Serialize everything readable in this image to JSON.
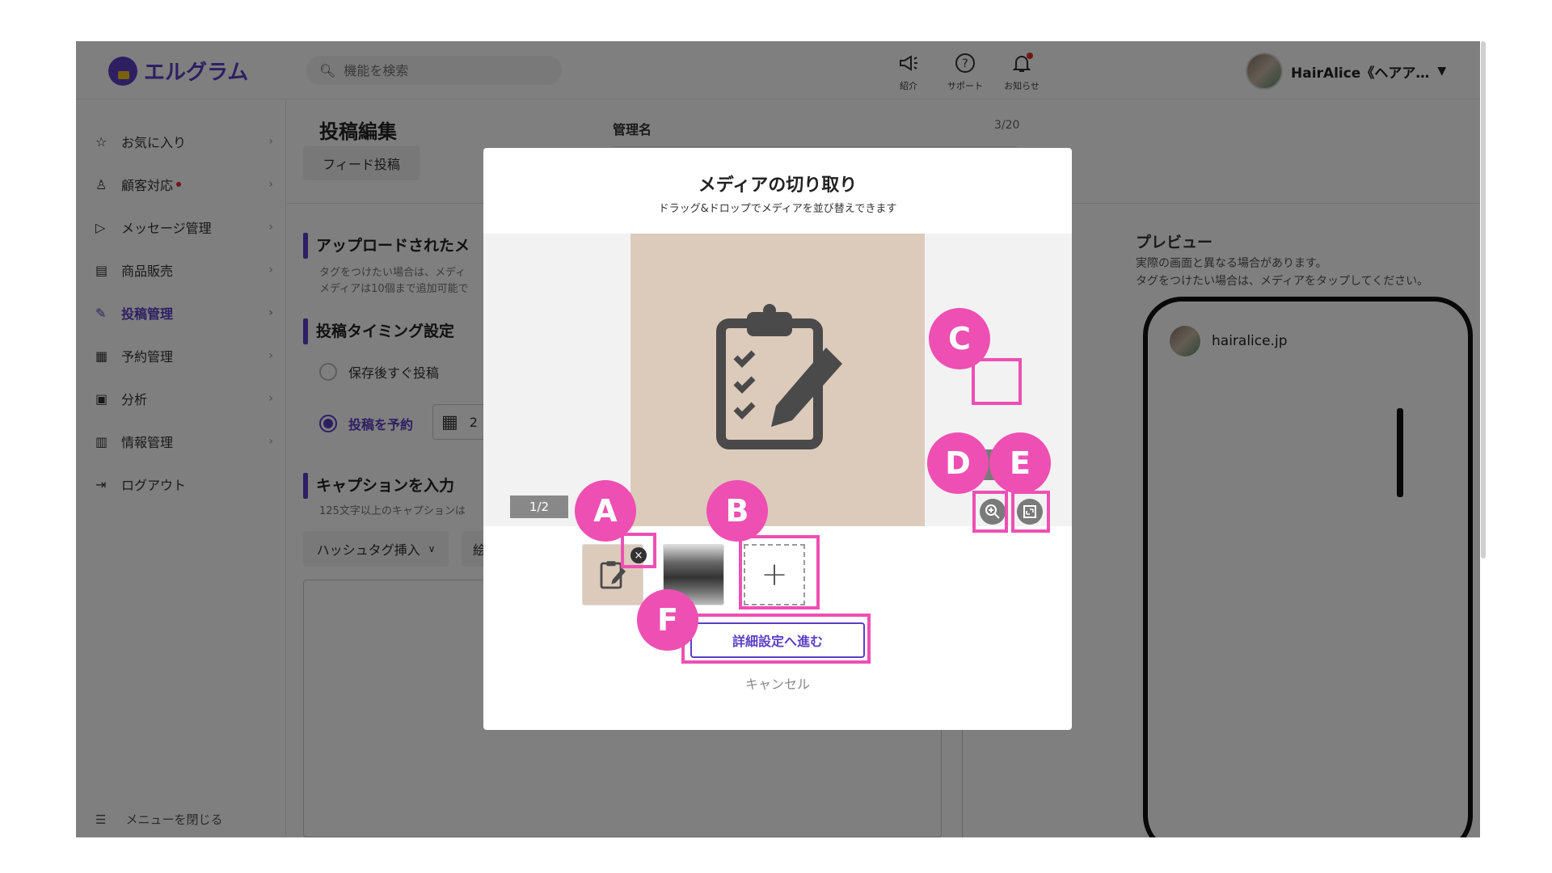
{
  "app": {
    "logo_text": "エルグラム"
  },
  "search": {
    "placeholder": "機能を検索"
  },
  "topbar": {
    "intro_label": "紹介",
    "support_label": "サポート",
    "news_label": "お知らせ",
    "user_name": "HairAlice《ヘアア…"
  },
  "sidebar": {
    "items": [
      {
        "label": "お気に入り",
        "icon": "star-icon"
      },
      {
        "label": "顧客対応",
        "icon": "user-icon"
      },
      {
        "label": "メッセージ管理",
        "icon": "send-icon"
      },
      {
        "label": "商品販売",
        "icon": "store-icon"
      },
      {
        "label": "投稿管理",
        "icon": "edit-icon"
      },
      {
        "label": "予約管理",
        "icon": "calendar-icon"
      },
      {
        "label": "分析",
        "icon": "report-icon"
      },
      {
        "label": "情報管理",
        "icon": "chart-icon"
      },
      {
        "label": "ログアウト",
        "icon": "logout-icon"
      }
    ],
    "close_label": "メニューを閉じる"
  },
  "page": {
    "title": "投稿編集",
    "tab": "フィード投稿",
    "mgmt_label": "管理名",
    "mgmt_count": "3/20",
    "upload_title": "アップロードされたメ",
    "upload_sub1": "タグをつけたい場合は、メディ",
    "upload_sub2": "メディアは10個まで追加可能で",
    "timing_title": "投稿タイミング設定",
    "radio_now": "保存後すぐ投稿",
    "radio_schedule": "投稿を予約",
    "date_value": "2",
    "caption_title": "キャプションを入力",
    "caption_sub": "125文字以上のキャプションは",
    "hashtag_btn": "ハッシュタグ挿入",
    "emoji_btn": "絵",
    "preview_title": "プレビュー",
    "preview_sub1": "実際の画面と異なる場合があります。",
    "preview_sub2": "タグをつけたい場合は、メディアをタップしてください。",
    "preview_user": "hairalice.jp"
  },
  "modal": {
    "title": "メディアの切り取り",
    "subtitle": "ドラッグ&ドロップでメディアを並び替えできます",
    "counter": "1/2",
    "next_button": "詳細設定へ進む",
    "cancel": "キャンセル"
  },
  "markers": {
    "a": "A",
    "b": "B",
    "c": "C",
    "d": "D",
    "e": "E",
    "f": "F"
  },
  "colors": {
    "accent": "#5c3ec6",
    "highlight": "#ee4fb3",
    "notification": "#e0302a"
  }
}
